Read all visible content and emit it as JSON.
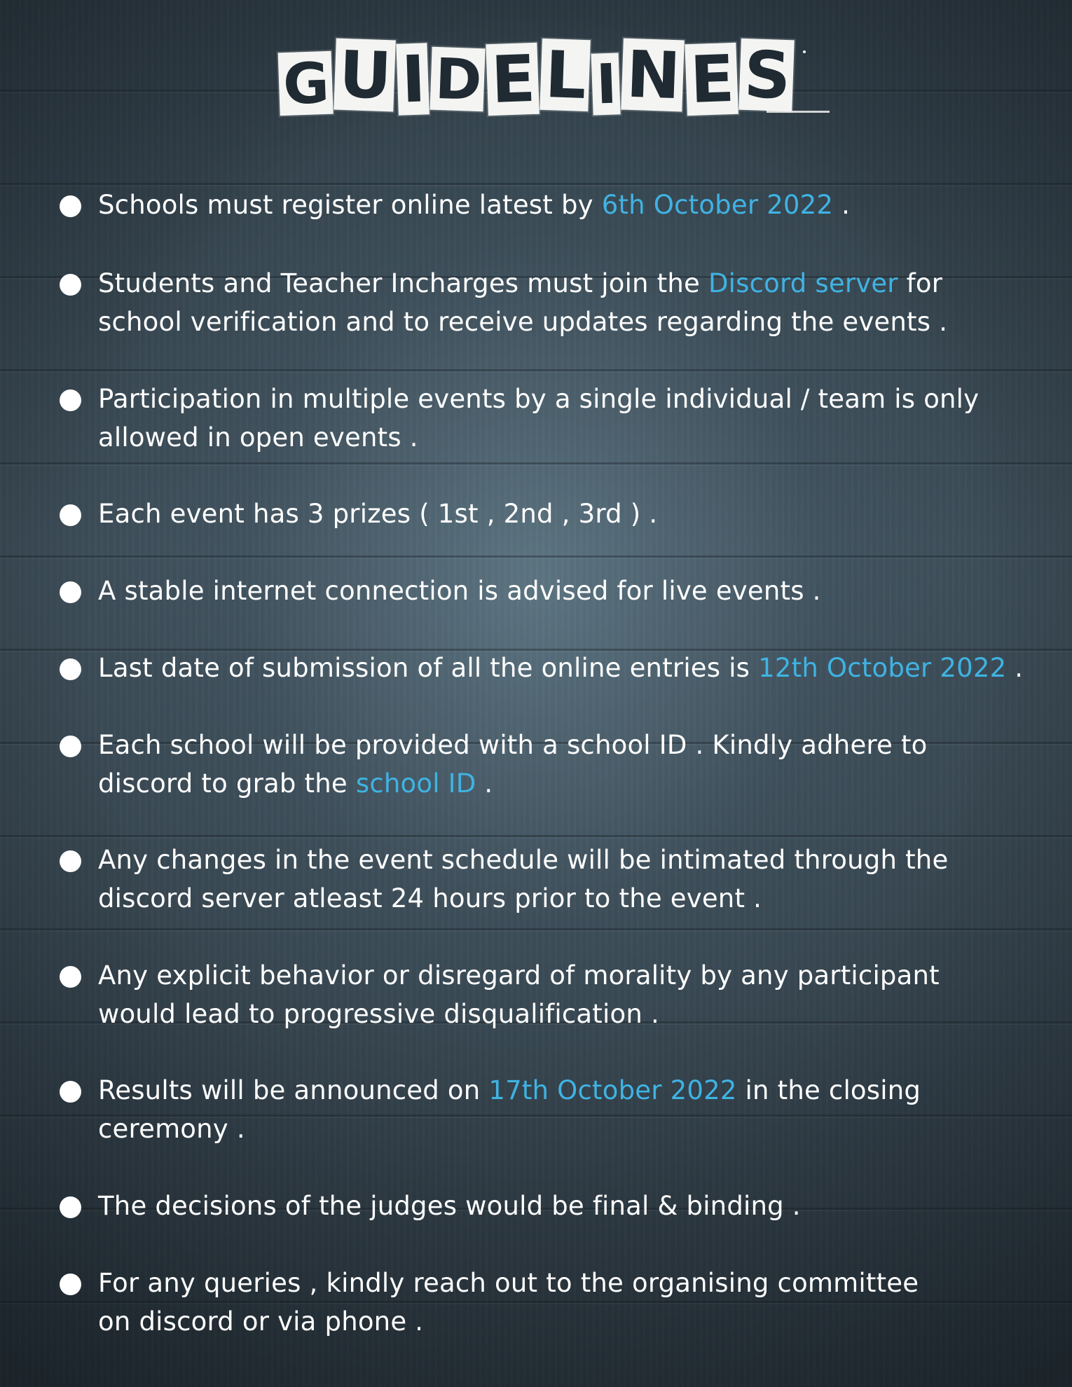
{
  "title": {
    "letters": [
      "G",
      "U",
      "i",
      "D",
      "E",
      "L",
      "i",
      "N",
      "E",
      "S"
    ]
  },
  "colors": {
    "highlight": "#3fb3e3",
    "text": "#ffffff",
    "background": "#36444e"
  },
  "items": [
    {
      "lines": [
        [
          {
            "t": "Schools must register online latest by "
          },
          {
            "t": "6th October 2022",
            "hl": true
          },
          {
            "t": " ."
          }
        ]
      ]
    },
    {
      "lines": [
        [
          {
            "t": "Students and Teacher Incharges must join the "
          },
          {
            "t": "Discord server",
            "hl": true
          },
          {
            "t": " for"
          }
        ],
        [
          {
            "t": "school verification and to receive updates regarding the events ."
          }
        ]
      ]
    },
    {
      "lines": [
        [
          {
            "t": "Participation in multiple events by a single individual / team is only"
          }
        ],
        [
          {
            "t": "allowed in open events ."
          }
        ]
      ]
    },
    {
      "lines": [
        [
          {
            "t": "Each event has 3 prizes ( 1st , 2nd , 3rd ) ."
          }
        ]
      ]
    },
    {
      "lines": [
        [
          {
            "t": "A stable internet connection is advised for live events ."
          }
        ]
      ]
    },
    {
      "lines": [
        [
          {
            "t": "Last date of submission of all the online entries is "
          },
          {
            "t": "12th October 2022",
            "hl": true
          },
          {
            "t": " ."
          }
        ]
      ]
    },
    {
      "lines": [
        [
          {
            "t": "Each school will be provided with a school ID . Kindly adhere to"
          }
        ],
        [
          {
            "t": "discord to grab the "
          },
          {
            "t": "school ID",
            "hl": true
          },
          {
            "t": " ."
          }
        ]
      ]
    },
    {
      "lines": [
        [
          {
            "t": "Any changes in the event schedule will be intimated through the"
          }
        ],
        [
          {
            "t": "discord server atleast 24 hours prior to the event ."
          }
        ]
      ]
    },
    {
      "lines": [
        [
          {
            "t": "Any explicit behavior or disregard of morality by any participant"
          }
        ],
        [
          {
            "t": "would lead to progressive disqualification ."
          }
        ]
      ]
    },
    {
      "lines": [
        [
          {
            "t": "Results will be announced on "
          },
          {
            "t": "17th October 2022",
            "hl": true
          },
          {
            "t": " in the closing"
          }
        ],
        [
          {
            "t": "ceremony ."
          }
        ]
      ]
    },
    {
      "lines": [
        [
          {
            "t": "The decisions of the judges would be final & binding ."
          }
        ]
      ]
    },
    {
      "lines": [
        [
          {
            "t": "For any queries , kindly reach out to the organising committee"
          }
        ],
        [
          {
            "t": "on discord or via phone ."
          }
        ]
      ]
    }
  ]
}
